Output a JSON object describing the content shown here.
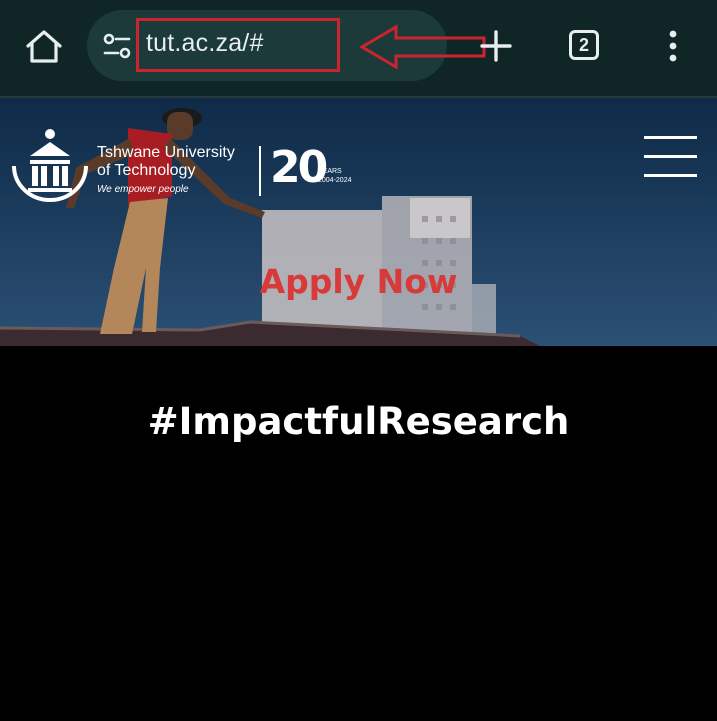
{
  "browser": {
    "url": "tut.ac.za/#",
    "tab_count": "2",
    "icons": {
      "home": "home-icon",
      "site_settings": "tune-icon",
      "new_tab": "plus-icon",
      "menu": "more-vert-icon"
    },
    "annotation_color": "#c9252e"
  },
  "site": {
    "university_name_line1": "Tshwane University",
    "university_name_line2": "of Technology",
    "tagline": "We empower people",
    "anniversary_number": "20",
    "anniversary_label": "YEARS",
    "anniversary_range": "2004-2024",
    "cta": "Apply Now",
    "cta_color": "#d83a3a",
    "section_heading": "#ImpactfulResearch"
  }
}
